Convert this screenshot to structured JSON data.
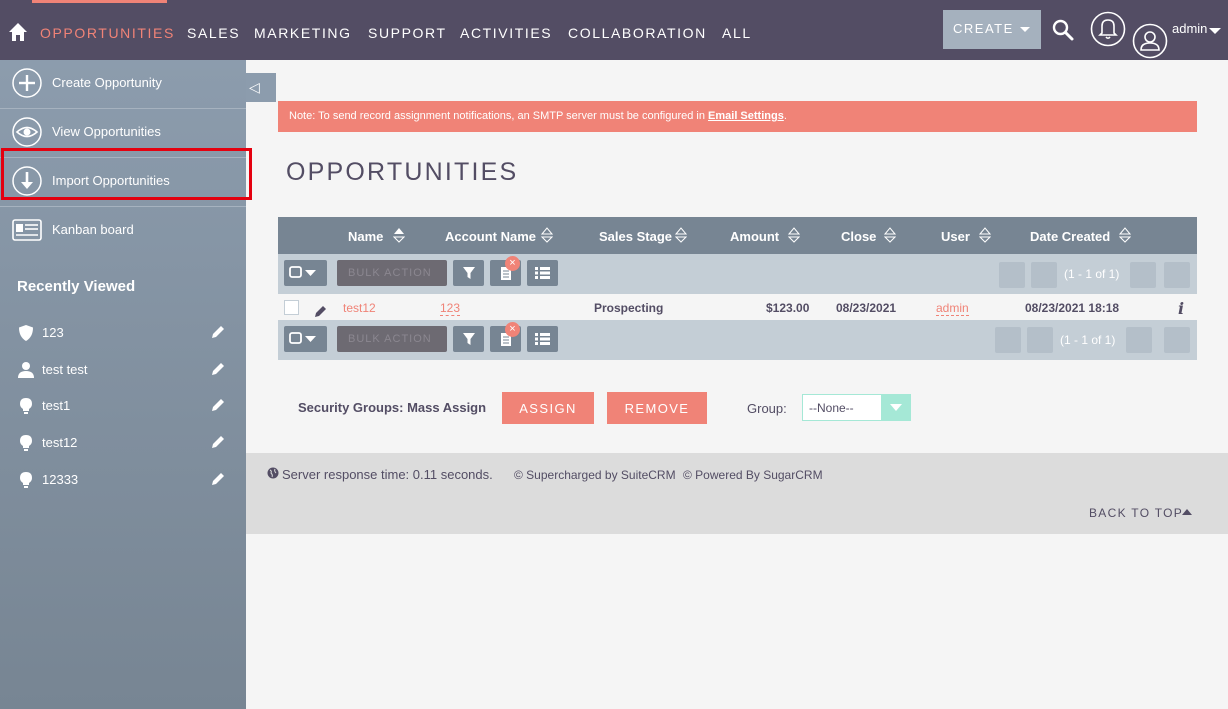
{
  "nav": {
    "items": [
      "OPPORTUNITIES",
      "SALES",
      "MARKETING",
      "SUPPORT",
      "ACTIVITIES",
      "COLLABORATION",
      "ALL"
    ],
    "create_label": "CREATE",
    "user_label": "admin"
  },
  "sidebar": {
    "actions": [
      {
        "label": "Create Opportunity",
        "icon": "plus-circle-icon"
      },
      {
        "label": "View Opportunities",
        "icon": "eye-icon"
      },
      {
        "label": "Import Opportunities",
        "icon": "download-icon"
      },
      {
        "label": "Kanban board",
        "icon": "kanban-icon"
      }
    ],
    "recent_title": "Recently Viewed",
    "recent": [
      {
        "label": "123",
        "icon": "shield-icon"
      },
      {
        "label": "test test",
        "icon": "person-icon"
      },
      {
        "label": "test1",
        "icon": "lightbulb-icon"
      },
      {
        "label": "test12",
        "icon": "lightbulb-icon"
      },
      {
        "label": "12333",
        "icon": "lightbulb-icon"
      }
    ]
  },
  "notice": {
    "text": "Note: To send record assignment notifications, an SMTP server must be configured in ",
    "link": "Email Settings",
    "end": "."
  },
  "page_title": "OPPORTUNITIES",
  "table": {
    "headers": [
      "Name",
      "Account Name",
      "Sales Stage",
      "Amount",
      "Close",
      "User",
      "Date Created"
    ],
    "bulk_label": "BULK ACTION",
    "pagination": "(1 - 1 of 1)",
    "rows": [
      {
        "name": "test12",
        "account": "123",
        "stage": "Prospecting",
        "amount": "$123.00",
        "close": "08/23/2021",
        "user": "admin",
        "created": "08/23/2021 18:18"
      }
    ]
  },
  "mass_assign": {
    "label": "Security Groups: Mass Assign",
    "assign": "ASSIGN",
    "remove": "REMOVE",
    "group_label": "Group:",
    "group_value": "--None--"
  },
  "footer": {
    "response": "Server response time: 0.11 seconds.",
    "suite": "© Supercharged by SuiteCRM",
    "sugar": "© Powered By SugarCRM",
    "back_to_top": "BACK TO TOP"
  },
  "colors": {
    "nav_bg": "#534d64",
    "accent": "#f08377",
    "sidebar": "#8c9cad",
    "table_header": "#778593"
  }
}
